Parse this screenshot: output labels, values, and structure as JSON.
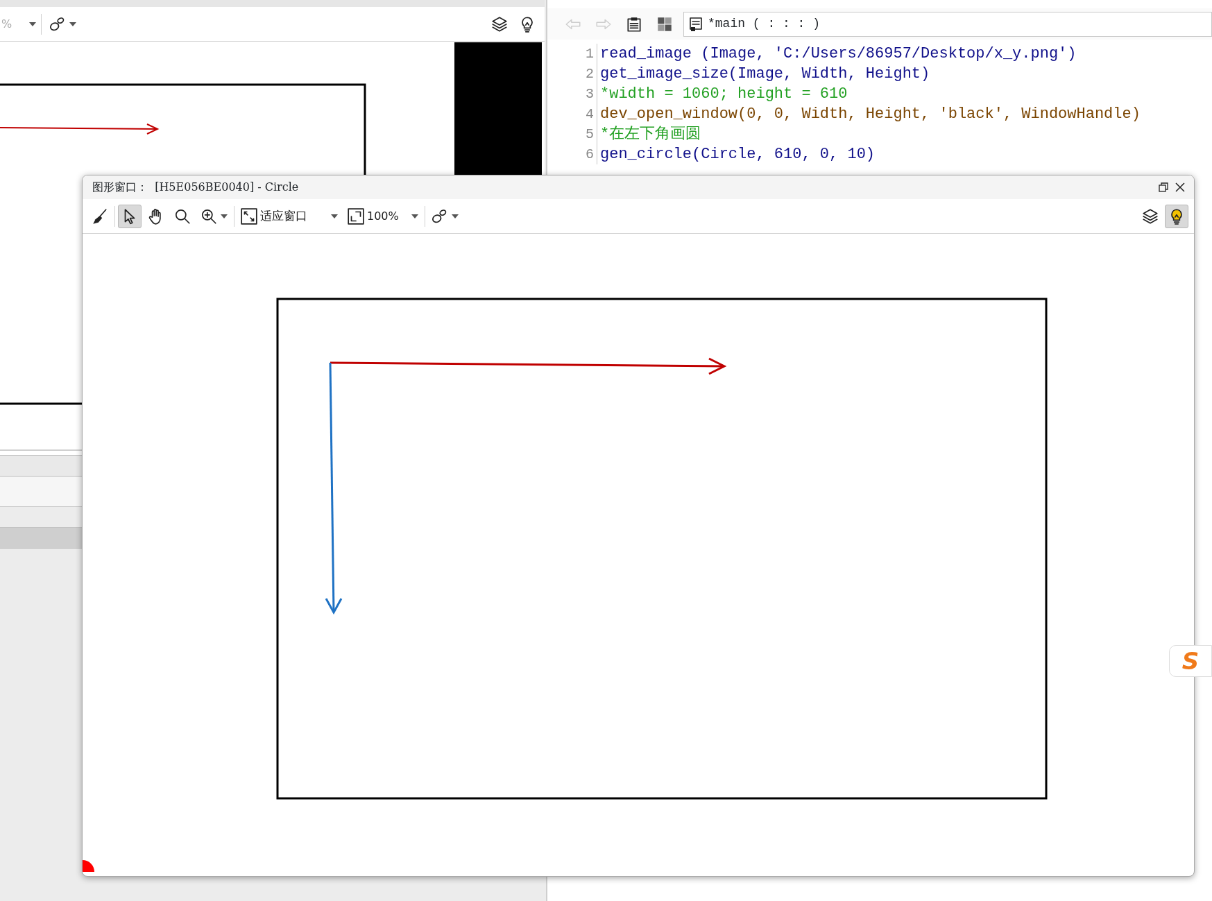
{
  "background_window": {
    "zoom_value": "%",
    "zoom_disabled": true,
    "tools": [
      {
        "kind": "shape",
        "selected": false
      }
    ],
    "right_tools": [
      {
        "kind": "layers",
        "selected": false
      },
      {
        "kind": "lightbulb",
        "selected": false
      }
    ]
  },
  "editor": {
    "toolbar": [
      {
        "kind": "back",
        "disabled": true
      },
      {
        "kind": "forward",
        "disabled": true
      },
      {
        "kind": "clipboard",
        "disabled": false
      },
      {
        "kind": "grid",
        "disabled": false
      }
    ],
    "procedure": "*main ( : : : )",
    "lines": [
      {
        "number": "1",
        "text": "read_image (Image, 'C:/Users/86957/Desktop/x_y.png')",
        "kind": "operator"
      },
      {
        "number": "2",
        "text": "get_image_size(Image, Width, Height)",
        "kind": "operator"
      },
      {
        "number": "3",
        "text": "*width = 1060; height = 610",
        "kind": "comment"
      },
      {
        "number": "4",
        "text": "dev_open_window(0, 0, Width, Height, 'black', WindowHandle)",
        "kind": "dev"
      },
      {
        "number": "5",
        "text": "*在左下角画圆",
        "kind": "comment"
      },
      {
        "number": "6",
        "text": "gen_circle(Circle, 610, 0, 10)",
        "kind": "operator"
      }
    ]
  },
  "graphics_window": {
    "title": "图形窗口：  [H5E056BE0040] - Circle",
    "tools": [
      {
        "kind": "broom",
        "selected": false
      },
      {
        "kind": "pointer",
        "selected": true
      },
      {
        "kind": "hand",
        "selected": false
      },
      {
        "kind": "search",
        "selected": false
      },
      {
        "kind": "zoom-in",
        "selected": false
      }
    ],
    "fit_label": "适应窗口",
    "zoom_label": "100%",
    "right_tools": [
      {
        "kind": "layers",
        "selected": false
      },
      {
        "kind": "lightbulb",
        "selected": true
      }
    ]
  },
  "ime_badge": {
    "text": "S"
  }
}
